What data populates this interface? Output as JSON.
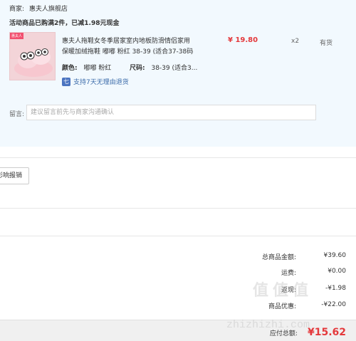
{
  "shop": {
    "label": "商家:",
    "name": "惠夫人旗舰店"
  },
  "promo_text": "活动商品已购满2件，已减1.98元现金",
  "product": {
    "image_tag": "惠夫人",
    "title_line1": "惠夫人拖鞋女冬季居家室内地板防滑情侣家用",
    "title_line2": "保暖加绒拖鞋 嘟嘟 粉红 38-39 (适合37-38码",
    "price": "¥ 19.80",
    "quantity": "x2",
    "stock": "有货",
    "color_label": "颜色:",
    "color_value": "嘟嘟 粉红",
    "size_label": "尺码:",
    "size_value": "38-39 (适合3...",
    "guarantee_text": "支持7天无理由退货"
  },
  "message": {
    "label": "留言:",
    "placeholder": "建议留言前先与商家沟通确认"
  },
  "apply_button_label": "影响报销",
  "summary": {
    "goods_total_label": "总商品金额:",
    "goods_total_value": "¥39.60",
    "shipping_label": "运费:",
    "shipping_value": "¥0.00",
    "discount_label": "返现:",
    "discount_value": "-¥1.98",
    "coupon_label": "商品优惠:",
    "coupon_value": "-¥22.00"
  },
  "payable": {
    "label": "应付总额:",
    "value": "¥15.62"
  },
  "watermark": {
    "text": "值值值",
    "url": "zhizhizhi.com"
  },
  "colors": {
    "accent_red": "#e4393c",
    "panel_bg": "#f2f9fe",
    "link_blue": "#3a6aa9"
  }
}
